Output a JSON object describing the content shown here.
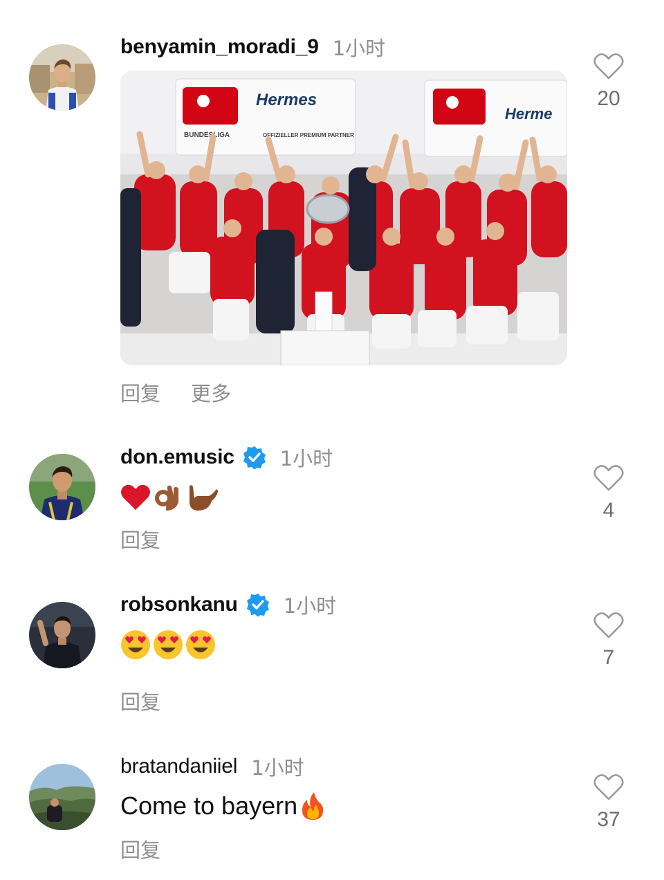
{
  "comments": [
    {
      "username": "benyamin_moradi_9",
      "verified": false,
      "time": "1小时",
      "text": "",
      "has_media": true,
      "media_texts": [
        "Hermes",
        "BUNDESLIGA",
        "OFFIZIELLER PREMIUM PARTNER"
      ],
      "actions": [
        "回复",
        "更多"
      ],
      "likes": "20"
    },
    {
      "username": "don.emusic",
      "verified": true,
      "time": "1小时",
      "emoji_names": [
        "red-heart",
        "ok-hand",
        "love-you-gesture"
      ],
      "actions": [
        "回复"
      ],
      "likes": "4"
    },
    {
      "username": "robsonkanu",
      "verified": true,
      "time": "1小时",
      "emoji_names": [
        "heart-eyes-face",
        "heart-eyes-face",
        "heart-eyes-face"
      ],
      "actions": [
        "回复"
      ],
      "likes": "7"
    },
    {
      "username": "bratandaniiel",
      "verified": false,
      "time": "1小时",
      "text": "Come to bayern",
      "text_emoji": "fire",
      "actions": [
        "回复"
      ],
      "likes": "37"
    }
  ],
  "colors": {
    "verified_blue": "#1d9bf0",
    "secondary_text": "#8e8e8e",
    "bayern_red": "#dc052d"
  }
}
